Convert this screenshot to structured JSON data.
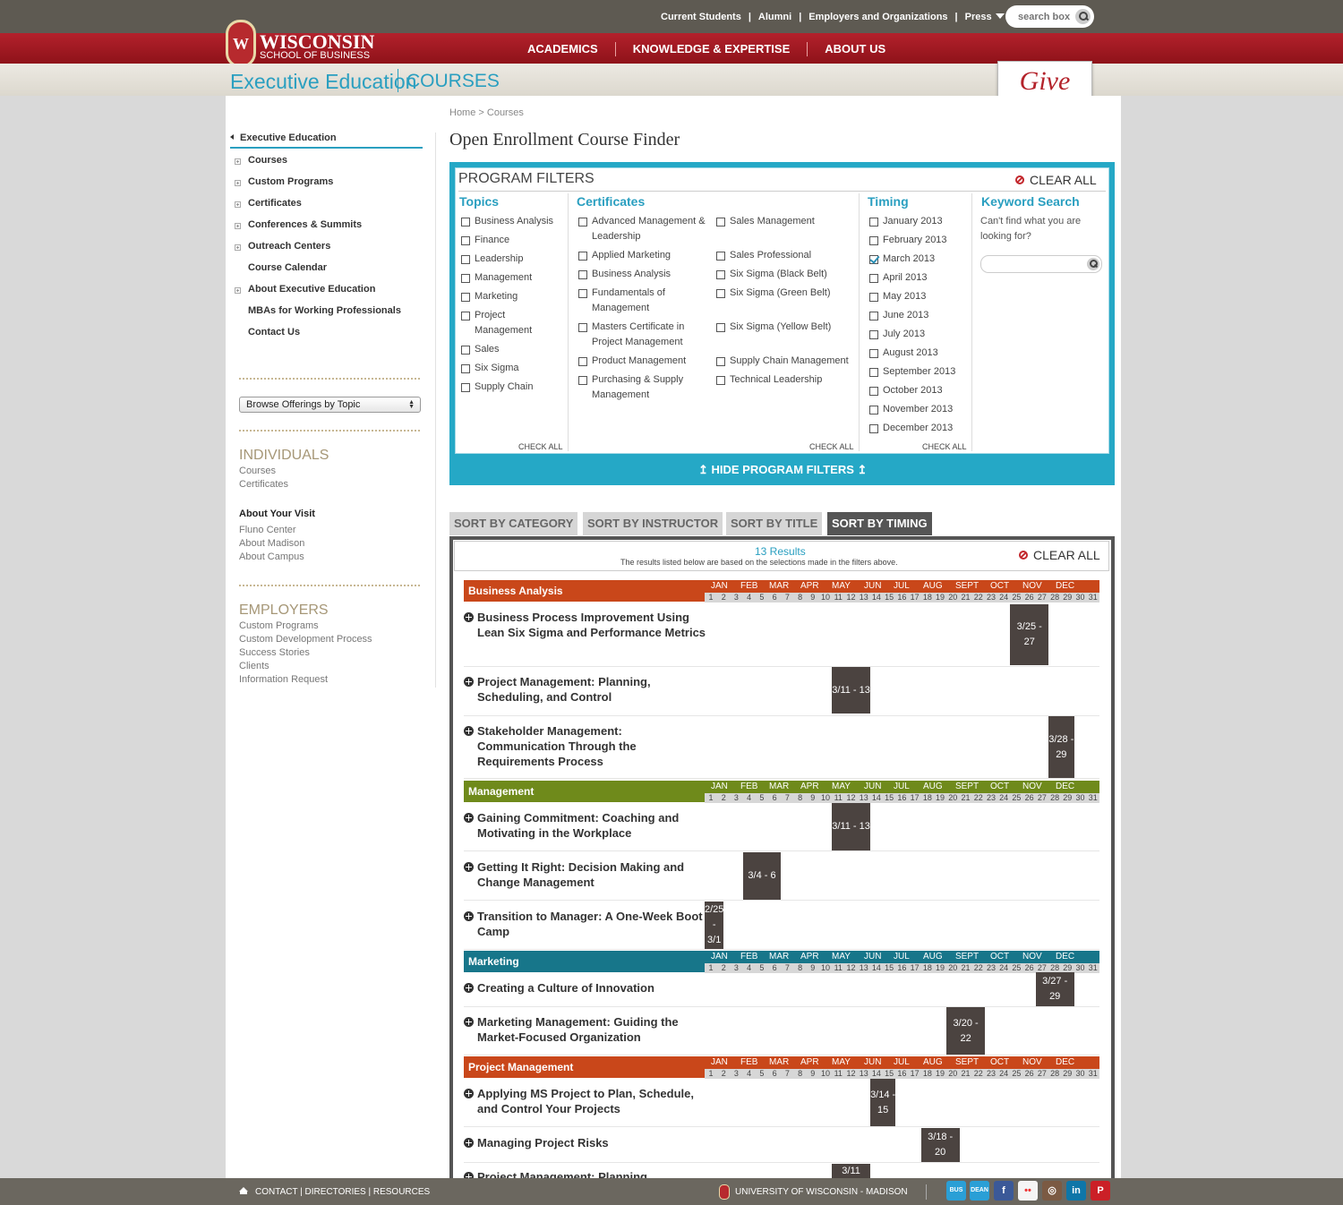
{
  "header": {
    "top_links": [
      "Current Students",
      "Alumni",
      "Employers and Organizations",
      "Press"
    ],
    "search_placeholder": "search box",
    "logo_main": "WISCONSIN",
    "logo_sub": "SCHOOL OF BUSINESS",
    "logo_crest_letter": "W",
    "nav": [
      "ACADEMICS",
      "KNOWLEDGE & EXPERTISE",
      "ABOUT US"
    ],
    "section_title": "Executive Education",
    "section_sub": "COURSES",
    "give_label": "Give"
  },
  "sidebar": {
    "head": "Executive Education",
    "items": [
      {
        "label": "Courses",
        "expandable": true
      },
      {
        "label": "Custom Programs",
        "expandable": true
      },
      {
        "label": "Certificates",
        "expandable": true
      },
      {
        "label": "Conferences & Summits",
        "expandable": true
      },
      {
        "label": "Outreach Centers",
        "expandable": true
      },
      {
        "label": "Course Calendar",
        "expandable": false
      },
      {
        "label": "About Executive Education",
        "expandable": true
      },
      {
        "label": "MBAs for Working Professionals",
        "expandable": false
      },
      {
        "label": "Contact Us",
        "expandable": false
      }
    ],
    "browse_select": "Browse Offerings by Topic",
    "individuals": {
      "head": "INDIVIDUALS",
      "links": [
        "Courses",
        "Certificates"
      ]
    },
    "visit": {
      "head": "About Your Visit",
      "links": [
        "Fluno Center",
        "About Madison",
        "About Campus"
      ]
    },
    "employers": {
      "head": "EMPLOYERS",
      "links": [
        "Custom Programs",
        "Custom Development Process",
        "Success Stories",
        "Clients",
        "Information Request"
      ]
    }
  },
  "main": {
    "breadcrumb": "Home > Courses",
    "title": "Open Enrollment Course Finder",
    "filters": {
      "title": "PROGRAM FILTERS",
      "clear_all": "CLEAR ALL",
      "check_all": "CHECK ALL",
      "hide_label": "HIDE PROGRAM FILTERS",
      "topics": {
        "title": "Topics",
        "items": [
          "Business Analysis",
          "Finance",
          "Leadership",
          "Management",
          "Marketing",
          "Project Management",
          "Sales",
          "Six Sigma",
          "Supply Chain"
        ]
      },
      "certificates": {
        "title": "Certificates",
        "left": [
          "Advanced Management & Leadership",
          "Applied Marketing",
          "Business Analysis",
          "Fundamentals of Management",
          "Masters Certificate in Project Management",
          "Product Management",
          "Purchasing & Supply Management"
        ],
        "right": [
          "Sales Management",
          "Sales Professional",
          "Six Sigma (Black Belt)",
          "Six Sigma (Green Belt)",
          "Six Sigma (Yellow Belt)",
          "Supply Chain Management",
          "Technical Leadership"
        ]
      },
      "timing": {
        "title": "Timing",
        "checked": "March 2013",
        "items": [
          "January 2013",
          "February 2013",
          "March 2013",
          "April 2013",
          "May 2013",
          "June 2013",
          "July 2013",
          "August 2013",
          "September 2013",
          "October 2013",
          "November 2013",
          "December 2013"
        ]
      },
      "keyword": {
        "title": "Keyword Search",
        "text": "Can't find what you are looking for?"
      }
    },
    "sort_tabs": [
      {
        "label": "SORT BY CATEGORY",
        "active": false
      },
      {
        "label": "SORT BY INSTRUCTOR",
        "active": false
      },
      {
        "label": "SORT BY TITLE",
        "active": false
      },
      {
        "label": "SORT BY TIMING",
        "active": true
      }
    ],
    "results": {
      "count": "13 Results",
      "note": "The results listed below are based on the selections made in the filters above.",
      "clear_all": "CLEAR ALL",
      "month_labels": [
        "JAN",
        "FEB",
        "MAR",
        "APR",
        "MAY",
        "JUN",
        "JUL",
        "AUG",
        "SEPT",
        "OCT",
        "NOV",
        "DEC"
      ],
      "categories": [
        {
          "name": "Business Analysis",
          "color": "#c9471a",
          "courses": [
            {
              "title": "Business Process Improvement Using Lean Six Sigma and Performance Metrics",
              "dates": "3/25 - 27"
            },
            {
              "title": "Project Management: Planning, Scheduling, and Control",
              "dates": "3/11 - 13"
            },
            {
              "title": "Stakeholder Management: Communication Through the Requirements Process",
              "dates": "3/28 - 29"
            }
          ]
        },
        {
          "name": "Management",
          "color": "#6f8a1b",
          "courses": [
            {
              "title": "Gaining Commitment: Coaching and Motivating in the Workplace",
              "dates": "3/11 - 13"
            },
            {
              "title": "Getting It Right: Decision Making and Change Management",
              "dates": "3/4 - 6"
            },
            {
              "title": "Transition to Manager: A One-Week Boot Camp",
              "dates": "2/25 - 3/1"
            }
          ]
        },
        {
          "name": "Marketing",
          "color": "#17768a",
          "courses": [
            {
              "title": "Creating a Culture of Innovation",
              "dates": "3/27 - 29"
            },
            {
              "title": "Marketing Management: Guiding the Market-Focused Organization",
              "dates": "3/20 - 22"
            }
          ]
        },
        {
          "name": "Project Management",
          "color": "#c9471a",
          "courses": [
            {
              "title": "Applying MS Project to Plan, Schedule, and Control Your Projects",
              "dates": "3/14 - 15"
            },
            {
              "title": "Managing Project Risks",
              "dates": "3/18 - 20"
            },
            {
              "title": "Project Management: Planning,",
              "dates": "3/11"
            }
          ]
        }
      ]
    }
  },
  "footer": {
    "links": "CONTACT | DIRECTORIES | RESOURCES",
    "university": "UNIVERSITY OF WISCONSIN - MADISON",
    "social": [
      {
        "name": "twitter-bus",
        "label": "BUS",
        "color": "#2a9fd6"
      },
      {
        "name": "twitter-dean",
        "label": "DEAN",
        "color": "#2a9fd6"
      },
      {
        "name": "facebook",
        "label": "f",
        "color": "#3b5998"
      },
      {
        "name": "flickr",
        "label": "••",
        "color": "#f5f5f5"
      },
      {
        "name": "instagram",
        "label": "◎",
        "color": "#7b5a43"
      },
      {
        "name": "linkedin",
        "label": "in",
        "color": "#0e76a8"
      },
      {
        "name": "pinterest",
        "label": "P",
        "color": "#cb2027"
      }
    ]
  }
}
